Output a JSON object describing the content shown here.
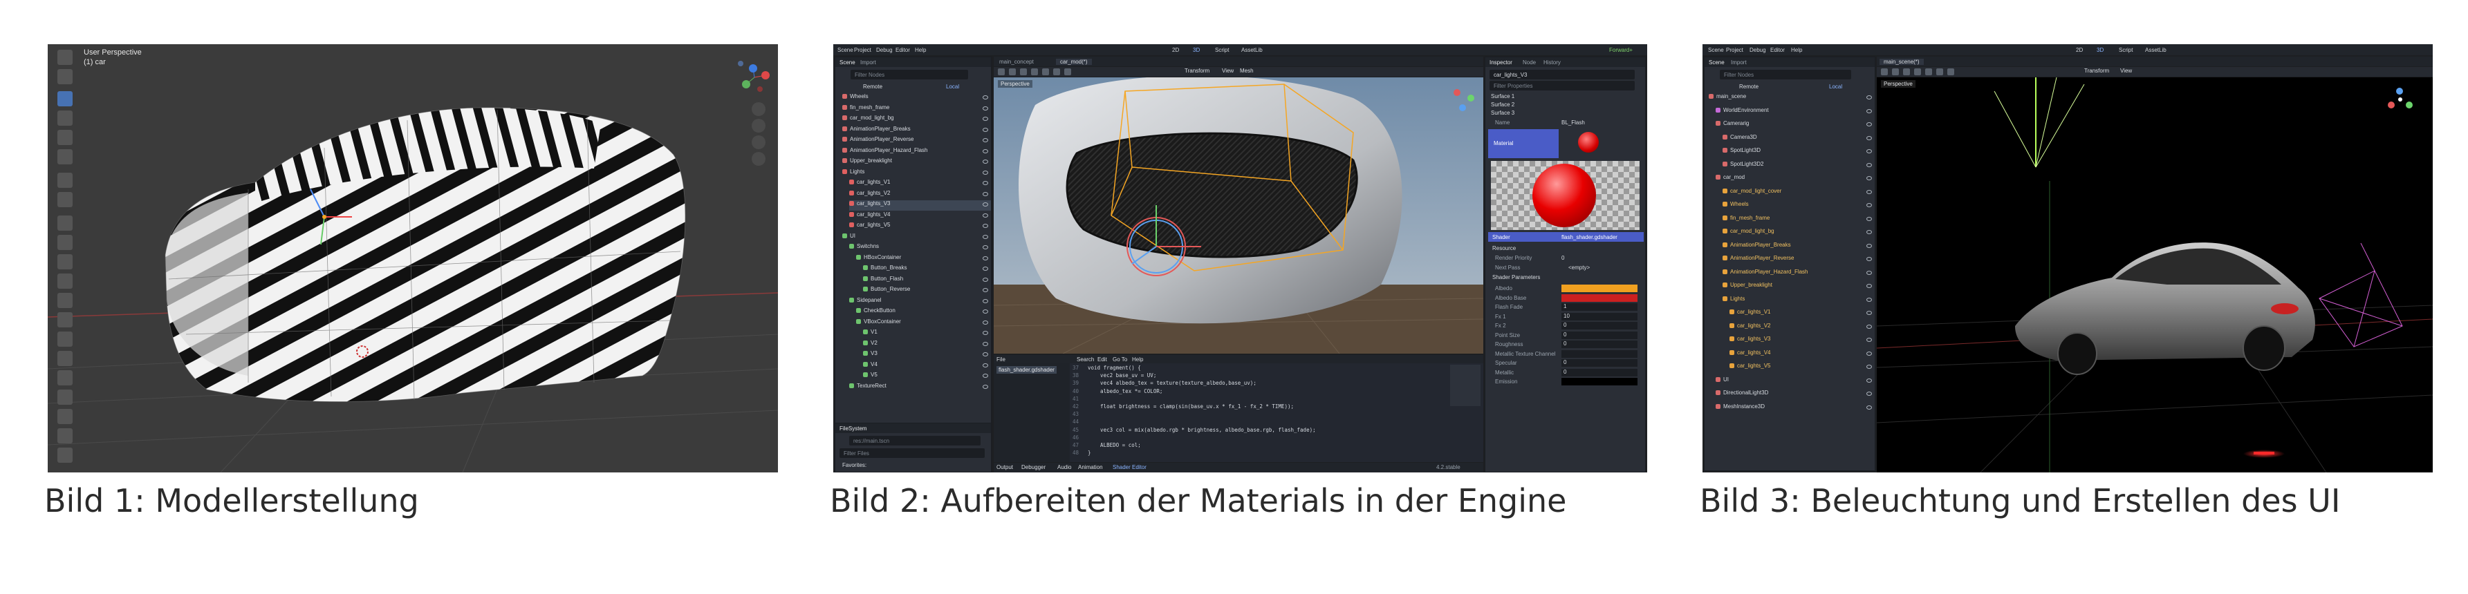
{
  "captions": {
    "bild1": "Bild 1: Modellerstellung",
    "bild2": "Bild 2: Aufbereiten der Materials in der Engine",
    "bild3": "Bild 3: Beleuchtung und Erstellen des UI"
  },
  "blender": {
    "view_name": "User Perspective",
    "object_name": "(1) car"
  },
  "godot2": {
    "menus": [
      "Scene",
      "Project",
      "Debug",
      "Editor",
      "Help"
    ],
    "top_buttons": [
      "2D",
      "3D",
      "Script",
      "AssetLib"
    ],
    "renderer": "Forward+",
    "scene_tabs": [
      "Scene",
      "Import"
    ],
    "filter_placeholder": "Filter Nodes",
    "remote_label": "Remote",
    "local_label": "Local",
    "tree": [
      "Wheels",
      "fin_mesh_frame",
      "car_mod_light_bg",
      "AnimationPlayer_Breaks",
      "AnimationPlayer_Reverse",
      "AnimationPlayer_Hazard_Flash",
      "Upper_breaklight",
      "Lights",
      "car_lights_V1",
      "car_lights_V2",
      "car_lights_V3",
      "car_lights_V4",
      "car_lights_V5",
      "UI",
      "Switchns",
      "HBoxContainer",
      "Button_Breaks",
      "Button_Flash",
      "Button_Reverse",
      "Sidepanel",
      "CheckButton",
      "VBoxContainer",
      "V1",
      "V2",
      "V3",
      "V4",
      "V5",
      "TextureRect"
    ],
    "filesystem_label": "FileSystem",
    "fs_path": "res://main.tscn",
    "fs_filter": "Filter Files",
    "fs_item": "Favorites:",
    "editor_tabs": [
      "main_concept",
      "car_mod(*)"
    ],
    "viewport_label": "Perspective",
    "view_menu": [
      "Transform",
      "View",
      "Mesh"
    ],
    "inspector_tabs": [
      "Inspector",
      "Node",
      "History"
    ],
    "inspector_node": "car_lights_V3",
    "filter_props": "Filter Properties",
    "surfaces": [
      "Surface 1",
      "Surface 2",
      "Surface 3"
    ],
    "name_label": "Name",
    "name_value": "BL_Flash",
    "material_label": "Material",
    "shader_label": "Shader",
    "shader_value": "flash_shader.gdshader",
    "resource_label": "Resource",
    "render_priority": "Render Priority",
    "render_priority_value": "0",
    "next_pass": "Next Pass",
    "next_pass_value": "<empty>",
    "shader_params": "Shader Parameters",
    "params": [
      {
        "name": "Albedo",
        "value": ""
      },
      {
        "name": "Albedo Base",
        "value": ""
      },
      {
        "name": "Flash Fade",
        "value": "1"
      },
      {
        "name": "Fx 1",
        "value": "10"
      },
      {
        "name": "Fx 2",
        "value": "0"
      },
      {
        "name": "Point Size",
        "value": "0"
      },
      {
        "name": "Roughness",
        "value": "0"
      },
      {
        "name": "Metallic Texture Channel",
        "value": ""
      },
      {
        "name": "Specular",
        "value": "0"
      },
      {
        "name": "Metallic",
        "value": "0"
      },
      {
        "name": "Emission",
        "value": ""
      }
    ],
    "script_tabs": [
      "Search",
      "Edit",
      "Go To",
      "Help"
    ],
    "script_file": "flash_shader.gdshader",
    "code_lines": [
      {
        "n": "37",
        "t": "void fragment() {"
      },
      {
        "n": "38",
        "t": "    vec2 base_uv = UV;"
      },
      {
        "n": "39",
        "t": "    vec4 albedo_tex = texture(texture_albedo,base_uv);"
      },
      {
        "n": "40",
        "t": "    albedo_tex *= COLOR;"
      },
      {
        "n": "41",
        "t": ""
      },
      {
        "n": "42",
        "t": "    float brightness = clamp(sin(base_uv.x * fx_1 - fx_2 * TIME));"
      },
      {
        "n": "43",
        "t": ""
      },
      {
        "n": "44",
        "t": ""
      },
      {
        "n": "45",
        "t": "    vec3 col = mix(albedo.rgb * brightness, albedo_base.rgb, flash_fade);"
      },
      {
        "n": "46",
        "t": ""
      },
      {
        "n": "47",
        "t": "    ALBEDO = col;"
      },
      {
        "n": "48",
        "t": "}"
      }
    ],
    "bottom_tabs": [
      "Output",
      "Debugger",
      "Audio",
      "Animation",
      "Shader Editor"
    ],
    "version_text": "4.2.stable"
  },
  "godot3": {
    "menus": [
      "Scene",
      "Project",
      "Debug",
      "Editor",
      "Help"
    ],
    "top_buttons": [
      "2D",
      "3D",
      "Script",
      "AssetLib"
    ],
    "scene_tabs": [
      "Scene",
      "Import"
    ],
    "filter_placeholder": "Filter Nodes",
    "remote_label": "Remote",
    "local_label": "Local",
    "tree": [
      "main_scene",
      "WorldEnvironment",
      "Camerarig",
      "Camera3D",
      "SpotLight3D",
      "SpotLight3D2",
      "car_mod",
      "car_mod_light_cover",
      "Wheels",
      "fin_mesh_frame",
      "car_mod_light_bg",
      "AnimationPlayer_Breaks",
      "AnimationPlayer_Reverse",
      "AnimationPlayer_Hazard_Flash",
      "Upper_breaklight",
      "Lights",
      "car_lights_V1",
      "car_lights_V2",
      "car_lights_V3",
      "car_lights_V4",
      "car_lights_V5",
      "UI",
      "DirectionalLight3D",
      "MeshInstance3D"
    ],
    "editor_tab": "main_scene(*)",
    "viewport_label": "Perspective",
    "view_menu": [
      "Transform",
      "View"
    ]
  },
  "colors": {
    "caption": "#2b2b2b",
    "godot_accent": "#8ab4ff",
    "orange_selection": "#f5a623",
    "blender_active": "#4772b3"
  }
}
